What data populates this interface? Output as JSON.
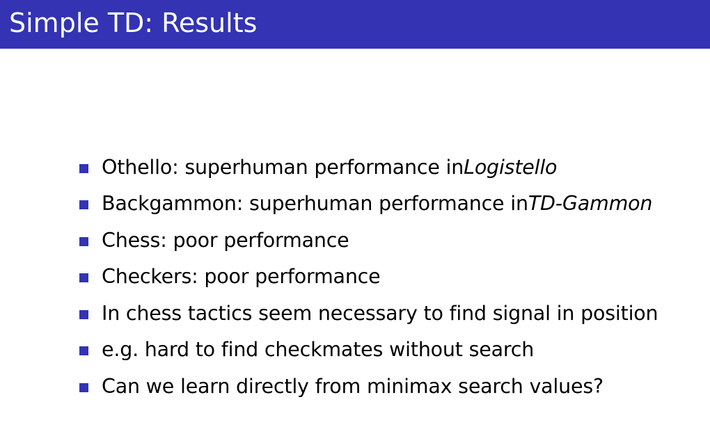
{
  "slide": {
    "title": "Simple TD: Results",
    "accent_color": "#3333b3",
    "bullet_icon": "square-bullet-icon",
    "bullets": [
      {
        "text": "Othello: superhuman performance in ",
        "emphasis": "Logistello"
      },
      {
        "text": "Backgammon: superhuman performance in ",
        "emphasis": "TD-Gammon"
      },
      {
        "text": "Chess: poor performance",
        "emphasis": ""
      },
      {
        "text": "Checkers: poor performance",
        "emphasis": ""
      },
      {
        "text": "In chess tactics seem necessary to find signal in position",
        "emphasis": ""
      },
      {
        "text": "e.g. hard to find checkmates without search",
        "emphasis": ""
      },
      {
        "text": "Can we learn directly from minimax search values?",
        "emphasis": ""
      }
    ]
  }
}
